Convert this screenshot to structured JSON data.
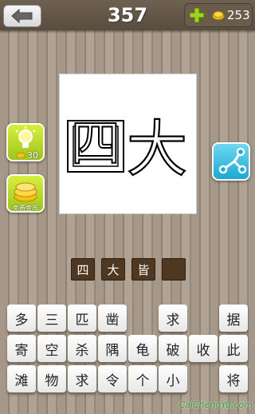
{
  "header": {
    "level": "357",
    "coin_count": "253"
  },
  "icons": {
    "back": "back-arrow-icon",
    "plus": "plus-icon",
    "coin": "coin-icon",
    "hint": "lightbulb-icon",
    "coins": "coin-stack-icon",
    "share": "share-icon"
  },
  "picture": {
    "char_1": "四",
    "char_2": "大"
  },
  "side": {
    "hint_cost": "30",
    "free_coins_label": "免费金币"
  },
  "answer": {
    "slots": [
      "四",
      "大",
      "皆",
      ""
    ]
  },
  "tiles": [
    [
      "多",
      "三",
      "匹",
      "凿",
      "",
      "求",
      "",
      "据"
    ],
    [
      "寄",
      "空",
      "杀",
      "隅",
      "龟",
      "破",
      "收",
      "此"
    ],
    [
      "滩",
      "物",
      "求",
      "令",
      "个",
      "小",
      "",
      "将"
    ]
  ],
  "watermark": "CaiChengYu.com",
  "colors": {
    "accent_green": "#9cc51a",
    "accent_blue": "#1aa9d4",
    "slot_brown": "#4f3822"
  }
}
